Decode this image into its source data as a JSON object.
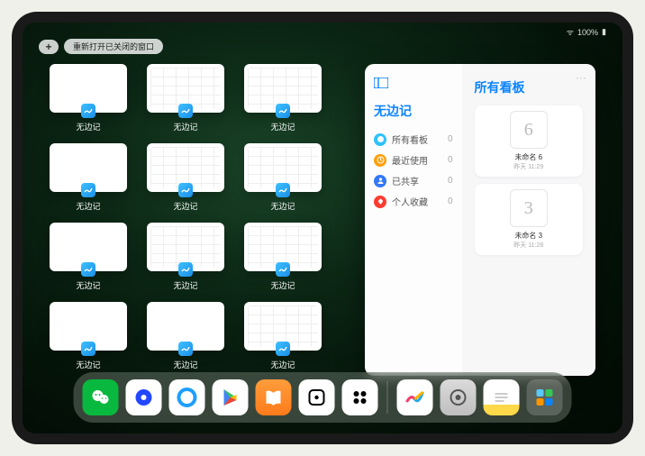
{
  "status": {
    "battery": "100%"
  },
  "topControls": {
    "plus": "+",
    "reopenLabel": "重新打开已关闭的窗口"
  },
  "thumbs": {
    "appLabel": "无边记",
    "items": [
      {
        "variant": "blank"
      },
      {
        "variant": "grid"
      },
      {
        "variant": "grid"
      },
      {
        "variant": "blank"
      },
      {
        "variant": "grid"
      },
      {
        "variant": "grid"
      },
      {
        "variant": "blank"
      },
      {
        "variant": "grid"
      },
      {
        "variant": "grid"
      },
      {
        "variant": "blank"
      },
      {
        "variant": "blank"
      },
      {
        "variant": "grid"
      }
    ]
  },
  "panel": {
    "leftTitle": "无边记",
    "rightTitle": "所有看板",
    "more": "···",
    "nav": [
      {
        "label": "所有看板",
        "count": "0",
        "color": "#2fc1ff"
      },
      {
        "label": "最近使用",
        "count": "0",
        "color": "#ff9f0a"
      },
      {
        "label": "已共享",
        "count": "0",
        "color": "#3478f6"
      },
      {
        "label": "个人收藏",
        "count": "0",
        "color": "#ff3b30"
      }
    ],
    "boards": [
      {
        "glyph": "6",
        "label": "未命名 6",
        "sub": "昨天 11:29"
      },
      {
        "glyph": "3",
        "label": "未命名 3",
        "sub": "昨天 11:28"
      }
    ]
  },
  "dock": {
    "apps": [
      {
        "name": "wechat"
      },
      {
        "name": "quark"
      },
      {
        "name": "qqbrowser"
      },
      {
        "name": "play"
      },
      {
        "name": "books"
      },
      {
        "name": "dice"
      },
      {
        "name": "barcode"
      }
    ],
    "recents": [
      {
        "name": "freeform"
      },
      {
        "name": "settings"
      },
      {
        "name": "notes"
      },
      {
        "name": "app-library"
      }
    ]
  }
}
